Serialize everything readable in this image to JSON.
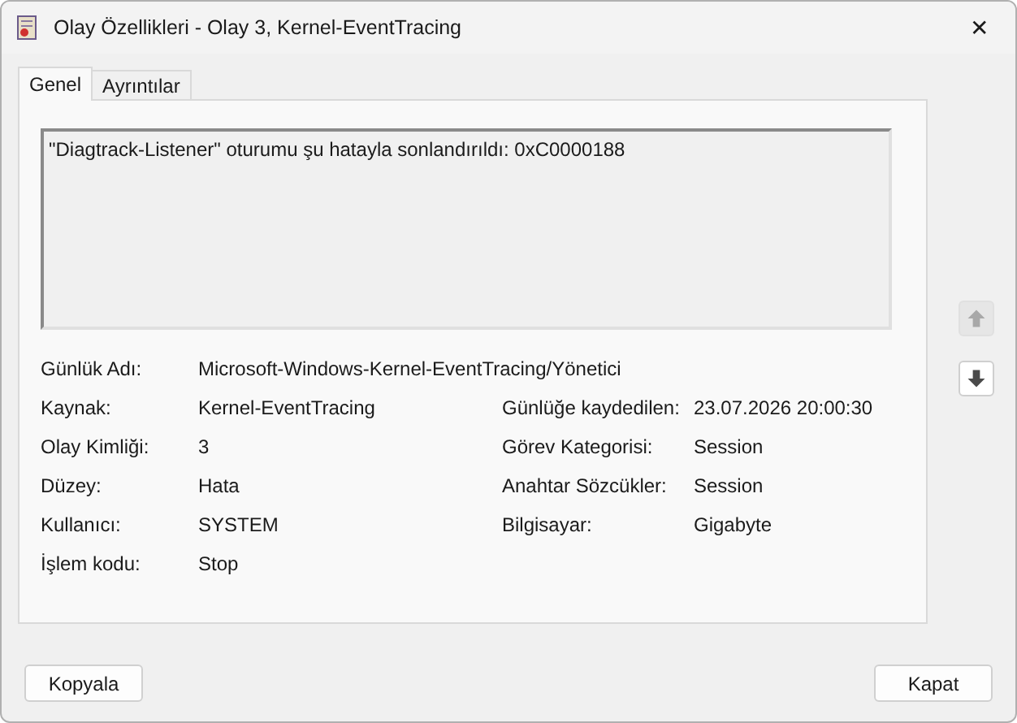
{
  "window": {
    "title": "Olay Özellikleri - Olay 3, Kernel-EventTracing",
    "close": "✕"
  },
  "tabs": [
    {
      "label": "Genel",
      "selected": true
    },
    {
      "label": "Ayrıntılar",
      "selected": false
    }
  ],
  "message": "\"Diagtrack-Listener\" oturumu şu hatayla sonlandırıldı: 0xC0000188",
  "rows": [
    {
      "fields": [
        {
          "label": "Günlük Adı:",
          "value": "Microsoft-Windows-Kernel-EventTracing/Yönetici"
        }
      ]
    },
    {
      "fields": [
        {
          "label": "Kaynak:",
          "value": "Kernel-EventTracing"
        },
        {
          "label": "Günlüğe kaydedilen:",
          "value": "23.07.2026 20:00:30"
        }
      ]
    },
    {
      "fields": [
        {
          "label": "Olay Kimliği:",
          "value": "3"
        },
        {
          "label": "Görev Kategorisi:",
          "value": "Session"
        }
      ]
    },
    {
      "fields": [
        {
          "label": "Düzey:",
          "value": "Hata"
        },
        {
          "label": "Anahtar Sözcükler:",
          "value": "Session"
        }
      ]
    },
    {
      "fields": [
        {
          "label": "Kullanıcı:",
          "value": "SYSTEM"
        },
        {
          "label": "Bilgisayar:",
          "value": "Gigabyte"
        }
      ]
    },
    {
      "fields": [
        {
          "label": "İşlem kodu:",
          "value": "Stop"
        }
      ]
    }
  ],
  "nav": [
    {
      "kind": "up",
      "disabled": true
    },
    {
      "kind": "down",
      "disabled": false
    }
  ],
  "buttons": [
    {
      "label": "Kopyala"
    },
    {
      "label": "Kapat"
    }
  ]
}
